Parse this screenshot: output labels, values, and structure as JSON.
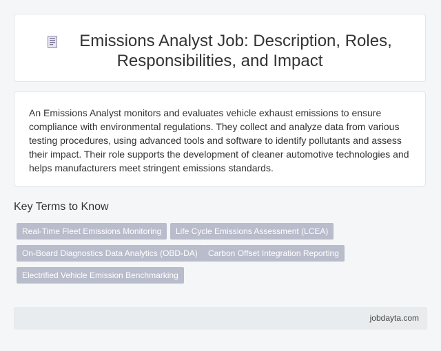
{
  "header": {
    "icon": "document-icon",
    "title": "Emissions Analyst Job: Description, Roles, Responsibilities, and Impact"
  },
  "description": "An Emissions Analyst monitors and evaluates vehicle exhaust emissions to ensure compliance with environmental regulations. They collect and analyze data from various testing procedures, using advanced tools and software to identify pollutants and assess their impact. Their role supports the development of cleaner automotive technologies and helps manufacturers meet stringent emissions standards.",
  "key_terms": {
    "heading": "Key Terms to Know",
    "items": [
      "Real-Time Fleet Emissions Monitoring",
      "Life Cycle Emissions Assessment (LCEA)",
      "On-Board Diagnostics Data Analytics (OBD-DA)",
      "Carbon Offset Integration Reporting",
      "Electrified Vehicle Emission Benchmarking"
    ]
  },
  "footer": {
    "site": "jobdayta.com"
  },
  "colors": {
    "tag_background": "#b9bccb",
    "page_background": "#f5f6f8",
    "footer_background": "#e9ecee"
  }
}
